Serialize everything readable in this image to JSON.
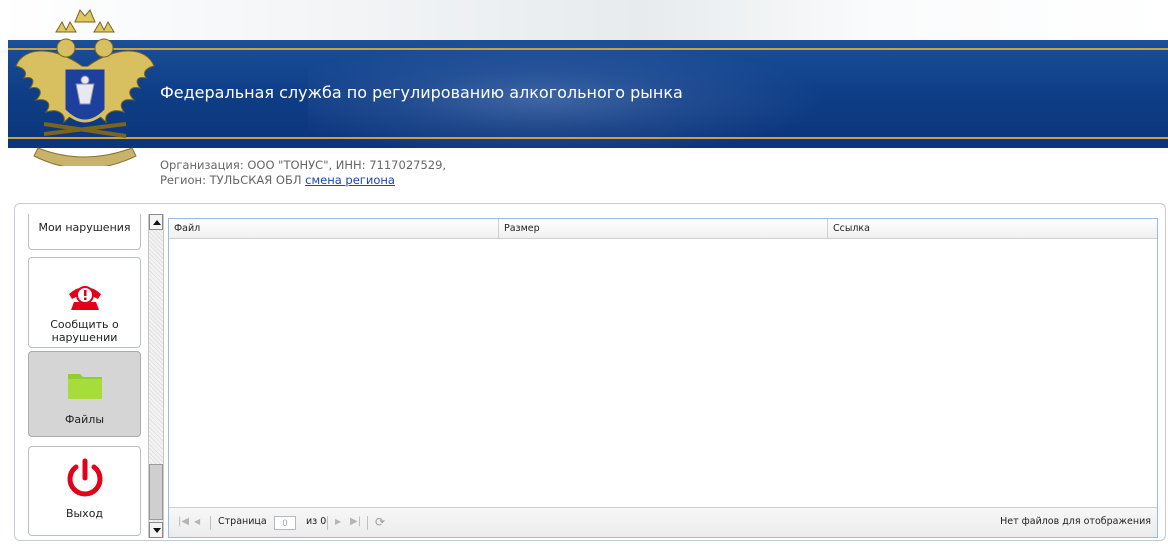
{
  "header": {
    "title": "Федеральная служба по регулированию алкогольного рынка",
    "emblem_icon": "double-headed-eagle-emblem-icon"
  },
  "org": {
    "line1": "Организация: ООО \"ТОНУС\", ИНН: 7117027529,",
    "region_label": "Регион: ТУЛЬСКАЯ ОБЛ",
    "change_region_link": "смена региона"
  },
  "sidebar": {
    "items": [
      {
        "label": "Мои нарушения",
        "icon": null,
        "active": false
      },
      {
        "label": "Сообщить о нарушении",
        "icon": "phone-alert-icon",
        "active": false
      },
      {
        "label": "Файлы",
        "icon": "folder-icon",
        "active": true
      },
      {
        "label": "Выход",
        "icon": "power-icon",
        "active": false
      }
    ]
  },
  "grid": {
    "columns": [
      "Файл",
      "Размер",
      "Ссылка"
    ],
    "rows": []
  },
  "pager": {
    "page_label": "Страница",
    "page_value": "0",
    "of_label": "из 0",
    "status": "Нет файлов для отображения"
  },
  "colors": {
    "banner_blue": "#0f3f88",
    "accent_gold": "#c9a23a",
    "link_blue": "#1a44b8",
    "alert_red": "#e2001a",
    "folder_green": "#8fcf2c"
  }
}
